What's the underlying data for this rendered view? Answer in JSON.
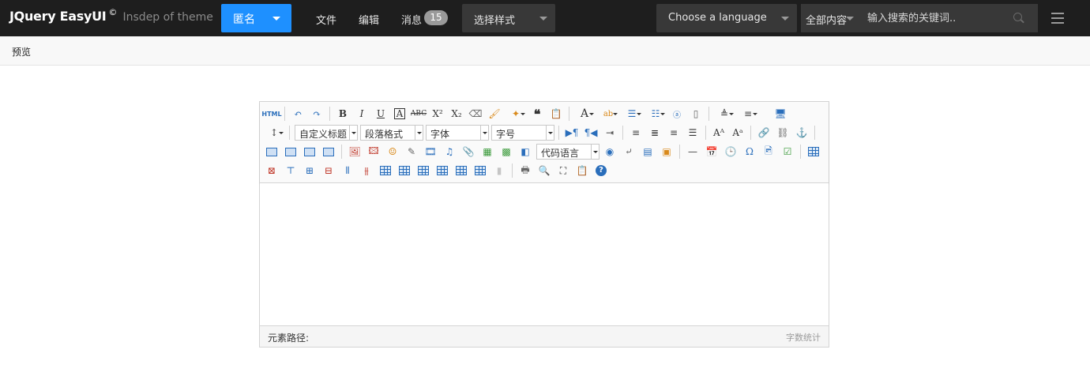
{
  "brand": {
    "name": "JQuery EasyUI",
    "copyright": "©",
    "tagline": "Insdep of theme"
  },
  "anon_button": {
    "label": "匿名"
  },
  "nav": [
    {
      "label": "文件"
    },
    {
      "label": "编辑"
    },
    {
      "label": "消息"
    }
  ],
  "messages_badge": "15",
  "style_select": {
    "value": "选择样式"
  },
  "language_select": {
    "value": "Choose a language"
  },
  "search": {
    "scope": "全部内容",
    "placeholder": "输入搜索的关键词.."
  },
  "tabs": [
    {
      "label": "预览"
    }
  ],
  "editor": {
    "custom_heading": "自定义标题",
    "paragraph_format": "段落格式",
    "font_family": "字体",
    "font_size": "字号",
    "code_language": "代码语言",
    "html_button": "HTML",
    "element_path_label": "元素路径:",
    "word_count_label": "字数统计"
  },
  "colors": {
    "topbar": "#1e1e1e",
    "accent": "#1e90ff",
    "badge": "#9a9a9a"
  }
}
